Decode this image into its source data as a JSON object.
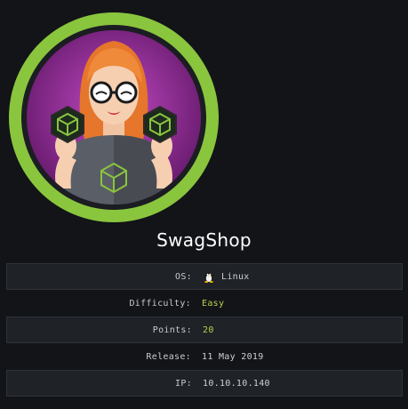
{
  "machine": {
    "name": "SwagShop",
    "avatar_icon": "hacker-girl-avatar-icon"
  },
  "info_rows": [
    {
      "label": "OS:",
      "value": "Linux",
      "icon": "tux-linux-icon"
    },
    {
      "label": "Difficulty:",
      "value": "Easy"
    },
    {
      "label": "Points:",
      "value": "20"
    },
    {
      "label": "Release:",
      "value": "11 May 2019"
    },
    {
      "label": "IP:",
      "value": "10.10.10.140"
    }
  ],
  "colors": {
    "background": "#121418",
    "ring": "#8ac53e",
    "avatar_bg": "#8a2b8e",
    "easy": "#b6d24a"
  }
}
